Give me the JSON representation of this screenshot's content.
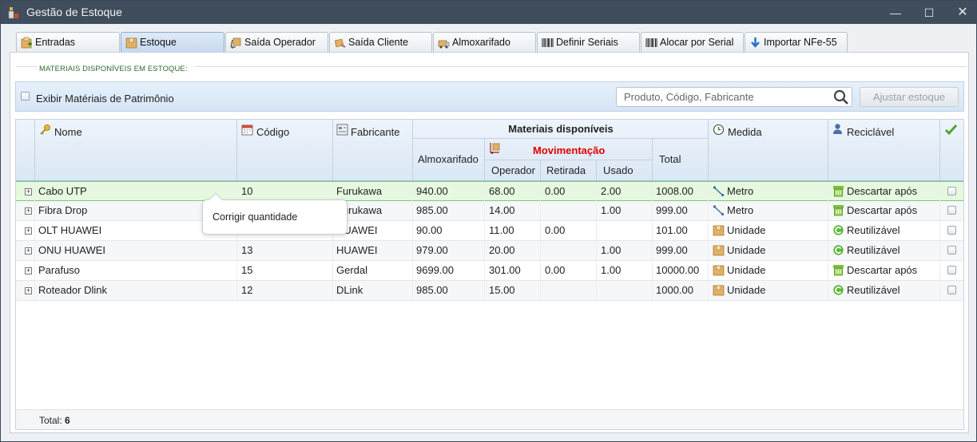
{
  "window": {
    "title": "Gestão de Estoque",
    "controls": {
      "minimize": "—",
      "maximize": "☐",
      "close": "✕"
    }
  },
  "tabs": [
    {
      "label": "Entradas",
      "icon": "entradas-icon"
    },
    {
      "label": "Estoque",
      "icon": "estoque-icon",
      "active": true
    },
    {
      "label": "Saída Operador",
      "icon": "saida-operador-icon"
    },
    {
      "label": "Saída Cliente",
      "icon": "saida-cliente-icon"
    },
    {
      "label": "Almoxarifado",
      "icon": "almoxarifado-icon"
    },
    {
      "label": "Definir Seriais",
      "icon": "barcode-icon"
    },
    {
      "label": "Alocar por Serial",
      "icon": "barcode-icon"
    },
    {
      "label": "Importar NFe-55",
      "icon": "download-arrow-icon"
    }
  ],
  "section": {
    "title": "MATERIAIS DISPONÍVEIS EM ESTOQUE:"
  },
  "toolbar": {
    "patrimonio_label": "Exibir Matériais de Patrimônio",
    "search_placeholder": "Produto, Código, Fabricante",
    "ajustar_label": "Ajustar estoque"
  },
  "grid": {
    "headers": {
      "nome": "Nome",
      "codigo": "Código",
      "fabricante": "Fabricante",
      "materiais": "Materiais disponíveis",
      "almoxarifado": "Almoxarifado",
      "movimentacao": "Movimentação",
      "operador": "Operador",
      "retirada": "Retirada",
      "usado": "Usado",
      "total": "Total",
      "medida": "Medida",
      "reciclavel": "Reciclável"
    },
    "rows": [
      {
        "nome": "Cabo UTP",
        "codigo": "10",
        "fabricante": "Furukawa",
        "almoxarifado": "940.00",
        "operador": "68.00",
        "retirada": "0.00",
        "usado": "2.00",
        "total": "1008.00",
        "medida": "Metro",
        "medida_icon": "metro-icon",
        "reciclavel": "Descartar após",
        "reciclavel_icon": "descartar-icon"
      },
      {
        "nome": "Fibra Drop",
        "codigo": "",
        "fabricante": "Furukawa",
        "almoxarifado": "985.00",
        "operador": "14.00",
        "retirada": "",
        "usado": "1.00",
        "total": "999.00",
        "medida": "Metro",
        "medida_icon": "metro-icon",
        "reciclavel": "Descartar após",
        "reciclavel_icon": "descartar-icon"
      },
      {
        "nome": "OLT HUAWEI",
        "codigo": "",
        "fabricante": "HUAWEI",
        "almoxarifado": "90.00",
        "operador": "11.00",
        "retirada": "0.00",
        "usado": "",
        "total": "101.00",
        "medida": "Unidade",
        "medida_icon": "unidade-icon",
        "reciclavel": "Reutilizável",
        "reciclavel_icon": "reutilizavel-icon"
      },
      {
        "nome": "ONU HUAWEI",
        "codigo": "13",
        "fabricante": "HUAWEI",
        "almoxarifado": "979.00",
        "operador": "20.00",
        "retirada": "",
        "usado": "1.00",
        "total": "999.00",
        "medida": "Unidade",
        "medida_icon": "unidade-icon",
        "reciclavel": "Reutilizável",
        "reciclavel_icon": "reutilizavel-icon"
      },
      {
        "nome": "Parafuso",
        "codigo": "15",
        "fabricante": "Gerdal",
        "almoxarifado": "9699.00",
        "operador": "301.00",
        "retirada": "0.00",
        "usado": "1.00",
        "total": "10000.00",
        "medida": "Unidade",
        "medida_icon": "unidade-icon",
        "reciclavel": "Descartar após",
        "reciclavel_icon": "descartar-icon"
      },
      {
        "nome": "Roteador Dlink",
        "codigo": "12",
        "fabricante": "DLink",
        "almoxarifado": "985.00",
        "operador": "15.00",
        "retirada": "",
        "usado": "",
        "total": "1000.00",
        "medida": "Unidade",
        "medida_icon": "unidade-icon",
        "reciclavel": "Reutilizável",
        "reciclavel_icon": "reutilizavel-icon"
      }
    ],
    "footer": {
      "total_label": "Total:",
      "total_value": "6"
    }
  },
  "context_menu": {
    "item": "Corrigir quantidade"
  },
  "colors": {
    "titlebar": "#3f4d5d",
    "movimentacao": "#e00000",
    "selected_row": "#e6f8e0",
    "section_title": "#2e6b2e"
  }
}
